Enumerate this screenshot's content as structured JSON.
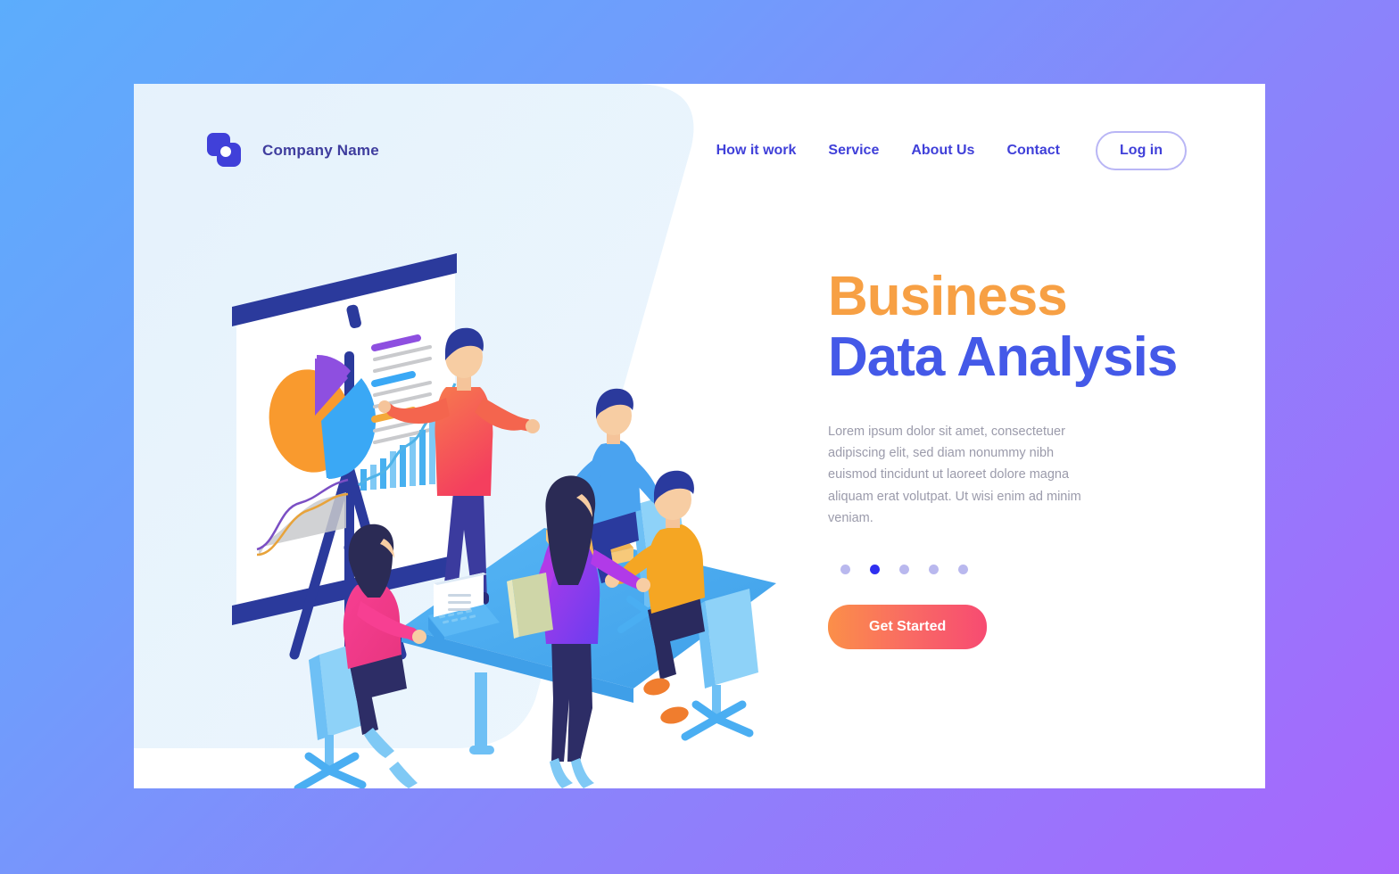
{
  "page": {
    "background_gradient_from": "#5cadfc",
    "background_gradient_to": "#a866fc",
    "card_background": "#ffffff",
    "illustration_backdrop": "#e8f3fd"
  },
  "header": {
    "logo_icon": "overlapping-squares-logo-icon",
    "logo_color": "#4040d9",
    "company_name": "Company Name",
    "nav_items": [
      {
        "label": "How it work"
      },
      {
        "label": "Service"
      },
      {
        "label": "About Us"
      },
      {
        "label": "Contact"
      }
    ],
    "login_label": "Log in",
    "nav_color": "#4040d9",
    "login_border_color": "#b9b6f5"
  },
  "hero": {
    "title_line1": "Business",
    "title_line2": "Data Analysis",
    "title_line1_color": "#f7a044",
    "title_line2_color": "#4459e8",
    "paragraph": "Lorem ipsum dolor sit amet, consectetuer adipiscing elit, sed diam nonummy nibh euismod tincidunt ut laoreet dolore magna aliquam erat volutpat. Ut wisi enim ad minim veniam.",
    "paragraph_color": "#9b9bab",
    "carousel": {
      "total": 5,
      "active_index": 1,
      "active_color": "#2f2ff0",
      "inactive_color": "#b9b8ee"
    },
    "cta_label": "Get Started",
    "cta_gradient_from": "#fb8f49",
    "cta_gradient_to": "#f74b72"
  },
  "illustration": {
    "name": "isometric-business-meeting-presentation",
    "whiteboard": {
      "frame_color": "#2b3a9c",
      "board_color": "#ffffff",
      "charts": [
        {
          "type": "pie",
          "name": "pie-chart",
          "slices": [
            {
              "label": "orange",
              "color": "#f99a2e",
              "value": 45
            },
            {
              "label": "purple",
              "color": "#8e4fe0",
              "value": 15
            },
            {
              "label": "blue",
              "color": "#3aa8f5",
              "value": 40
            }
          ]
        },
        {
          "type": "bar",
          "name": "bar-chart-with-trendline",
          "values": [
            8,
            12,
            10,
            16,
            14,
            22,
            20,
            30,
            27,
            38,
            36,
            48,
            52,
            62,
            70
          ],
          "bar_color": "#47b0f0",
          "line_color": "#4fb3e8"
        },
        {
          "type": "area",
          "name": "area-chart",
          "fill_color": "#c9cacd",
          "curve_colors": [
            "#7b4fc4",
            "#e8a33a"
          ]
        },
        {
          "type": "text-rows",
          "name": "legend-text-rows",
          "highlight_colors": [
            "#8e4fe0",
            "#3aa8f5",
            "#f4a93a"
          ],
          "line_color": "#c9cacd"
        }
      ]
    },
    "people": [
      {
        "name": "presenter-standing",
        "shirt": "#f4654e",
        "pants": "#3b3b9e",
        "hair": "#2b3a9c"
      },
      {
        "name": "woman-at-laptop",
        "top": "#f73f92",
        "pants": "#2d2d66",
        "hair": "#2b2b55"
      },
      {
        "name": "woman-standing-with-folder",
        "top": "#b13ae8",
        "pants": "#2d2d66",
        "hair": "#2b2b55"
      },
      {
        "name": "man-seated-blue",
        "shirt": "#4aa3f0",
        "pants": "#2a3a9e",
        "hair": "#2b3a9c"
      },
      {
        "name": "man-seated-yellow",
        "shirt": "#f5a623",
        "pants": "#2a2a5e",
        "hair": "#2a3a9e",
        "shoes": "#f07d2e"
      }
    ],
    "furniture": {
      "table_color": "#4aaef2",
      "chair_color": "#5bc0f5",
      "laptop_screen": "#ffffff",
      "folder_color": "#f0b555"
    }
  }
}
